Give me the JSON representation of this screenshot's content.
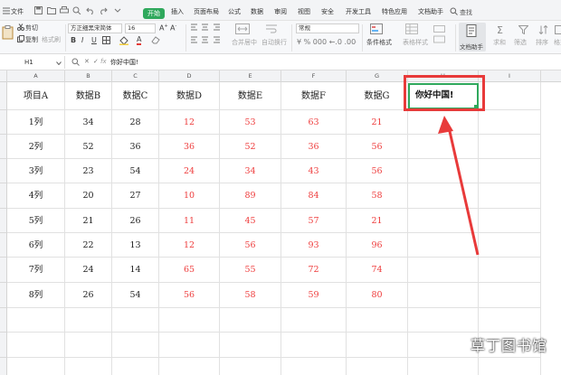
{
  "menubar": {
    "file": "文件",
    "tabs": [
      "开始",
      "插入",
      "页面布局",
      "公式",
      "数据",
      "审阅",
      "视图",
      "安全",
      "开发工具",
      "特色应用",
      "文档助手"
    ],
    "active_tab": "开始",
    "search": "查找"
  },
  "ribbon": {
    "cut": "剪切",
    "copy": "复制",
    "format_painter": "格式刷",
    "font": "方正细黑宋简体",
    "size": "16",
    "merge": "合并居中",
    "wrap": "自动换行",
    "number_format": "常规",
    "cond_format": "条件格式",
    "table_style": "表格样式",
    "doc_helper": "文档助手",
    "sum": "求和",
    "filter": "筛选",
    "sort": "排序",
    "format": "格式",
    "accent": "#2fa85c"
  },
  "formula_bar": {
    "cell_ref": "H1",
    "fx": "fx",
    "content": "你好中国!"
  },
  "columns": [
    "A",
    "B",
    "C",
    "D",
    "E",
    "F",
    "G",
    "H",
    "I"
  ],
  "rows": [
    [
      "项目A",
      "数据B",
      "数据C",
      "数据D",
      "数据E",
      "数据F",
      "数据G"
    ],
    [
      "1列",
      "34",
      "28",
      "12",
      "53",
      "63",
      "21"
    ],
    [
      "2列",
      "52",
      "36",
      "36",
      "52",
      "36",
      "56"
    ],
    [
      "3列",
      "23",
      "54",
      "24",
      "34",
      "43",
      "56"
    ],
    [
      "4列",
      "20",
      "27",
      "10",
      "89",
      "84",
      "58"
    ],
    [
      "5列",
      "21",
      "26",
      "11",
      "45",
      "57",
      "21"
    ],
    [
      "6列",
      "22",
      "13",
      "12",
      "56",
      "93",
      "96"
    ],
    [
      "7列",
      "24",
      "14",
      "65",
      "55",
      "72",
      "74"
    ],
    [
      "8列",
      "26",
      "54",
      "56",
      "58",
      "59",
      "80"
    ]
  ],
  "active_cell": {
    "ref": "H1",
    "value": "你好中国!"
  },
  "watermark": "草丁图书馆",
  "colors": {
    "red_text": "#ee3b3b",
    "callout": "#e83a3a",
    "selection": "#2fa85c"
  }
}
